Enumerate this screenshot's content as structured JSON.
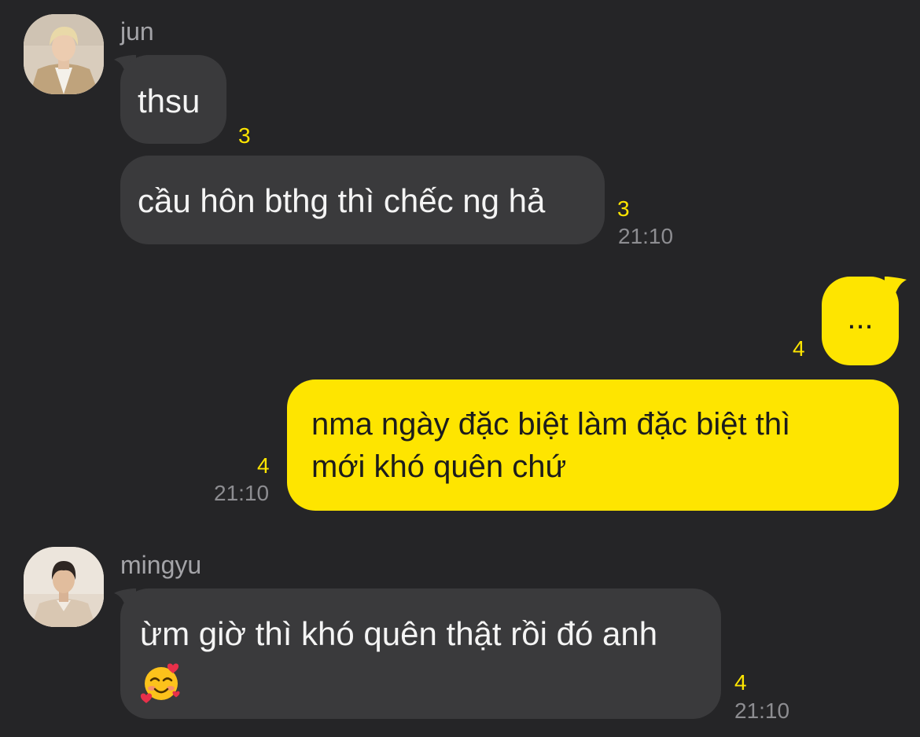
{
  "colors": {
    "background": "#252527",
    "incoming_bubble": "#3a3a3c",
    "outgoing_bubble": "#fee500",
    "unread_count": "#fee500",
    "timestamp": "#8d8d91"
  },
  "messages": [
    {
      "sender": "jun",
      "avatar_icon": "user-avatar-photo",
      "items": [
        {
          "text": "thsu",
          "unread": "3",
          "time": ""
        },
        {
          "text": "cầu hôn bthg thì chếc ng hả",
          "unread": "3",
          "time": "21:10"
        }
      ]
    },
    {
      "sender": "me",
      "items": [
        {
          "text": "...",
          "unread": "4",
          "time": ""
        },
        {
          "line1": "nma ngày đặc biệt làm đặc biệt thì",
          "line2": "mới khó quên chứ",
          "unread": "4",
          "time": "21:10"
        }
      ]
    },
    {
      "sender": "mingyu",
      "avatar_icon": "user-avatar-photo",
      "items": [
        {
          "text": "ừm giờ thì khó quên thật rồi đó anh",
          "emoji": "smiling-face-with-hearts-icon",
          "unread": "4",
          "time": "21:10"
        }
      ]
    }
  ]
}
